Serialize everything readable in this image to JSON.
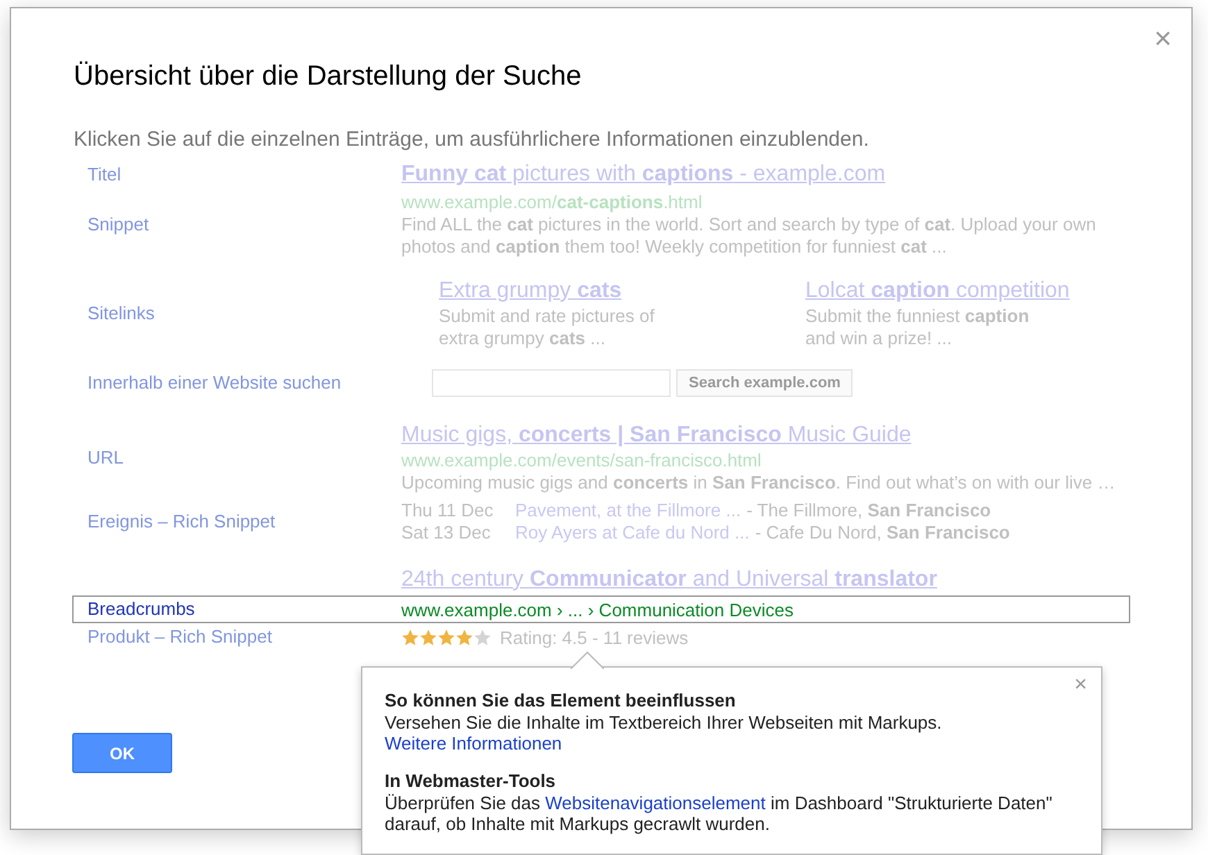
{
  "dialog": {
    "title": "Übersicht über die Darstellung der Suche",
    "subtitle": "Klicken Sie auf die einzelnen Einträge, um ausführlichere Informationen einzublenden.",
    "close": "×",
    "ok": "OK"
  },
  "rows": [
    {
      "kind": "title",
      "label": "Titel",
      "selected": false,
      "title": "**Funny cat** pictures with **captions** - example.com"
    },
    {
      "kind": "snippet",
      "label": "Snippet",
      "selected": false,
      "url": "www.example.com/**cat-captions**.html",
      "lines": [
        "Find ALL the **cat** pictures in the world. Sort and search by type of **cat**. Upload your own",
        "photos and **caption** them too! Weekly competition for funniest **cat** ..."
      ]
    },
    {
      "kind": "sitelinks",
      "label": "Sitelinks",
      "selected": false,
      "links": [
        {
          "title": "Extra grumpy **cats**",
          "lines": [
            "Submit and rate pictures of",
            "extra grumpy **cats** ..."
          ]
        },
        {
          "title": "Lolcat **caption** competition",
          "lines": [
            "Submit the funniest **caption**",
            "and win a prize! ..."
          ]
        }
      ]
    },
    {
      "kind": "search",
      "label": "Innerhalb einer Website suchen",
      "selected": false,
      "button": "Search example.com"
    },
    {
      "kind": "result",
      "label": "URL",
      "selected": false,
      "title": "Music gigs, **concerts | San Francisco** Music Guide",
      "url": "www.example.com/events/san-francisco.html",
      "lines": [
        "Upcoming music gigs and **concerts** in **San Francisco**. Find out what’s on with our live …"
      ]
    },
    {
      "kind": "event",
      "label": "Ereignis – Rich Snippet",
      "selected": false,
      "events": [
        {
          "date": "Thu 11 Dec",
          "link": "Pavement, at the Fillmore ...",
          "place": "- The Fillmore, **San Francisco**"
        },
        {
          "date": "Sat 13 Dec",
          "link": "Roy Ayers at Cafe du Nord ...",
          "place": "- Cafe Du Nord, **San Francisco**"
        }
      ]
    },
    {
      "kind": "title",
      "selected": false,
      "title": "24th century **Communicator** and Universal **translator**"
    },
    {
      "kind": "breadcrumb",
      "label": "Breadcrumbs",
      "selected": true,
      "url": "www.example.com › ... › Communication Devices"
    },
    {
      "kind": "product",
      "label": "Produkt – Rich Snippet",
      "selected": false,
      "stars": 4,
      "rating": "Rating: 4.5 - 11 reviews"
    }
  ],
  "popup": {
    "close": "×",
    "sections": [
      {
        "heading": "So können Sie das Element beeinflussen",
        "before": "Versehen Sie die Inhalte im Textbereich Ihrer Webseiten mit Markups. ",
        "link": "Weitere Informationen"
      },
      {
        "heading": "In Webmaster-Tools",
        "before": "Überprüfen Sie das ",
        "link": "Websitenavigationselement",
        "after": " im Dashboard \"Strukturierte Daten\" darauf, ob Inhalte mit Markups gecrawlt wurden."
      }
    ]
  }
}
